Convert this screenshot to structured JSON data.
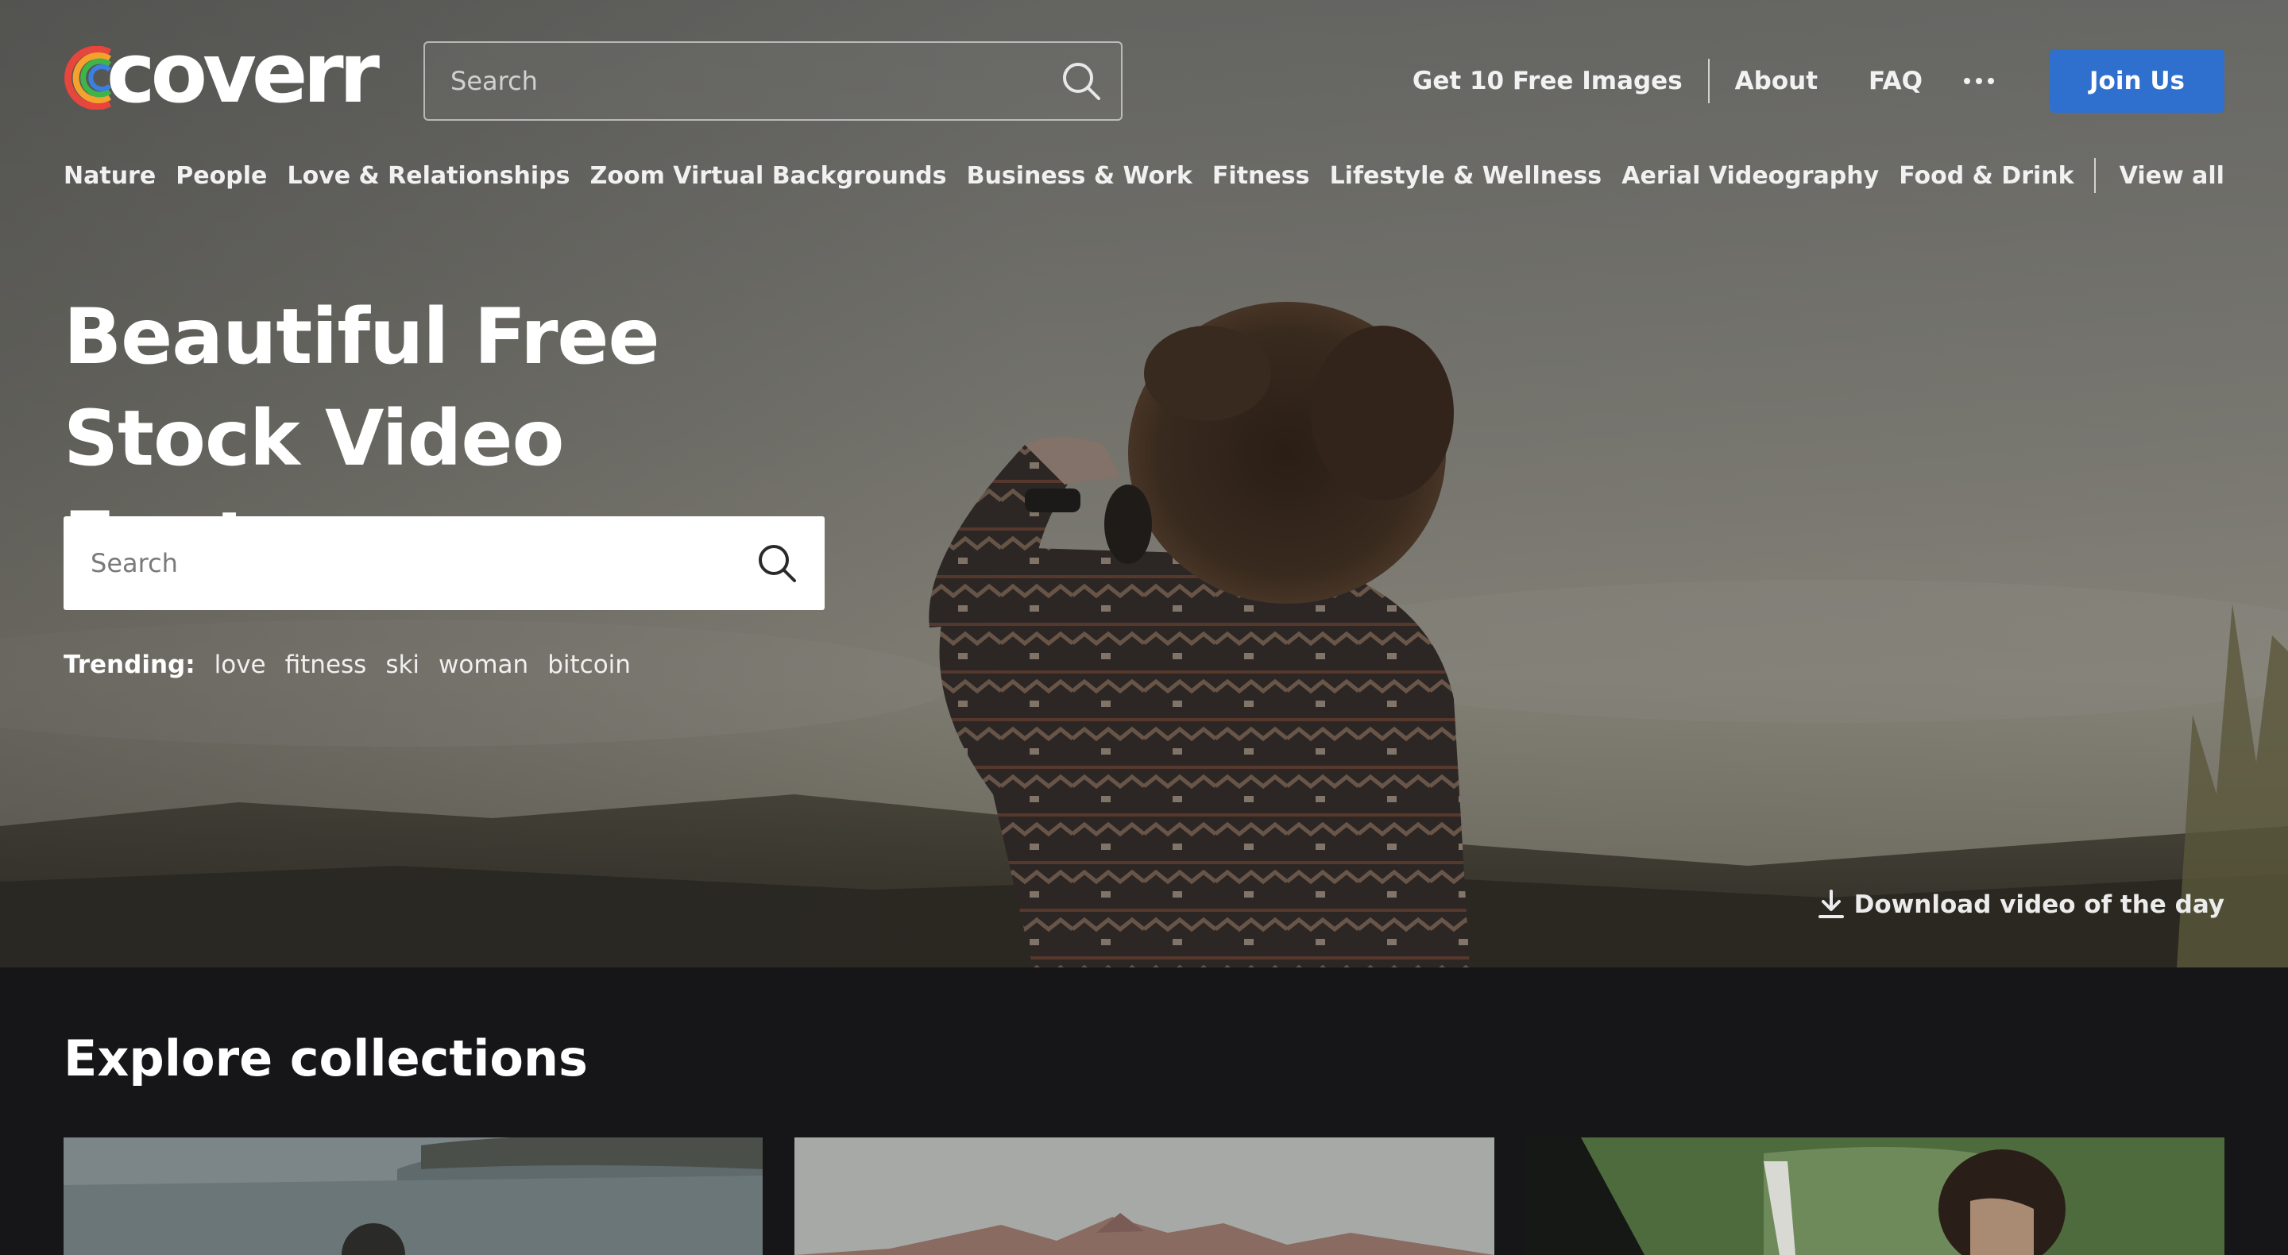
{
  "header": {
    "logo_text": "coverr",
    "search_placeholder": "Search",
    "links": {
      "free_images": "Get 10 Free Images",
      "about": "About",
      "faq": "FAQ"
    },
    "join_label": "Join Us"
  },
  "categories": [
    "Nature",
    "People",
    "Love & Relationships",
    "Zoom Virtual Backgrounds",
    "Business & Work",
    "Fitness",
    "Lifestyle & Wellness",
    "Aerial Videography",
    "Food & Drink"
  ],
  "view_all_label": "View all",
  "hero": {
    "title": "Beautiful Free Stock Video Footage",
    "search_placeholder": "Search",
    "trending_label": "Trending:",
    "trending_tags": [
      "love",
      "fitness",
      "ski",
      "woman",
      "bitcoin"
    ],
    "download_label": "Download video of the day"
  },
  "collections": {
    "title": "Explore collections"
  },
  "colors": {
    "accent": "#2f6fcd",
    "page_bg": "#161619"
  },
  "icons": {
    "search": "search-icon",
    "more": "more-dots-icon",
    "download": "download-icon"
  }
}
